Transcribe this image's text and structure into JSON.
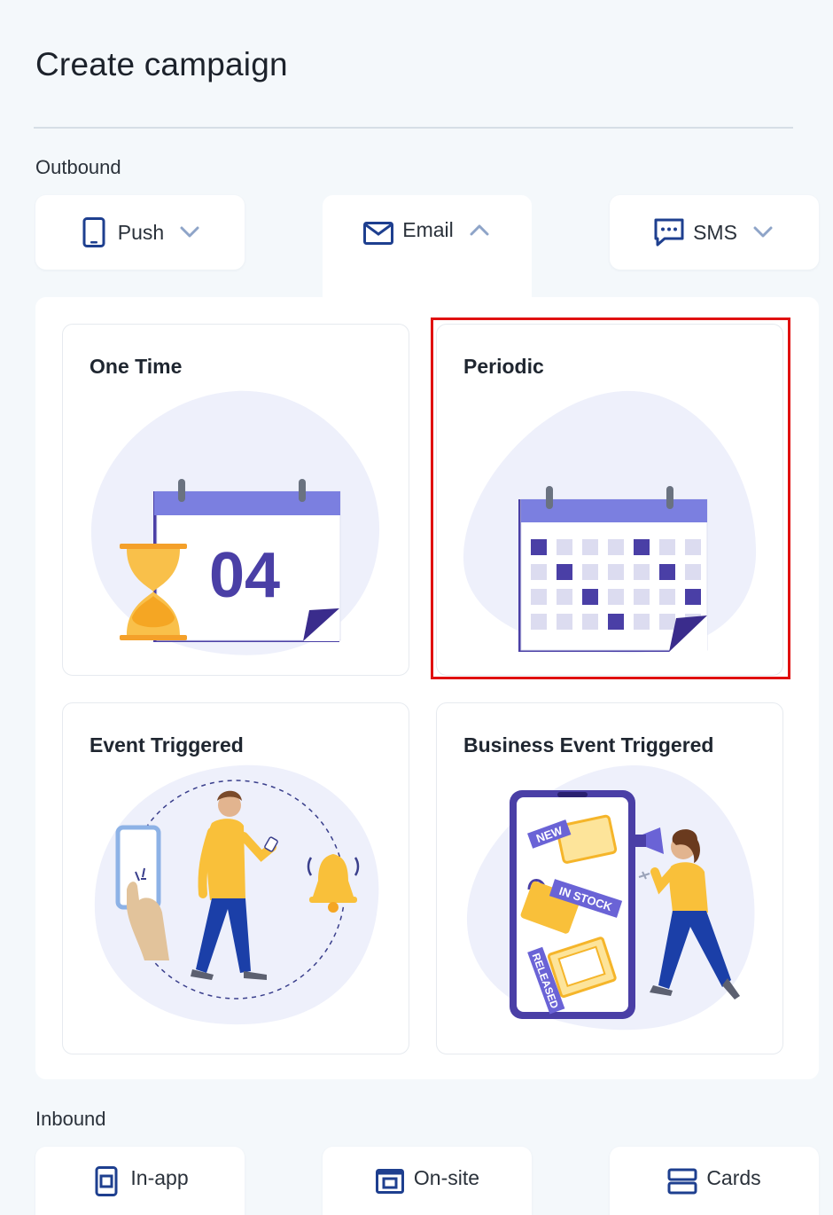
{
  "page": {
    "title": "Create campaign"
  },
  "outbound": {
    "label": "Outbound",
    "tabs": [
      {
        "label": "Push",
        "icon": "phone-icon",
        "state": "collapsed"
      },
      {
        "label": "Email",
        "icon": "mail-icon",
        "state": "expanded"
      },
      {
        "label": "SMS",
        "icon": "sms-icon",
        "state": "collapsed"
      }
    ]
  },
  "email_options": [
    {
      "title": "One Time",
      "illustration": "calendar-hourglass-illustration",
      "date_number": "04"
    },
    {
      "title": "Periodic",
      "illustration": "periodic-calendar-illustration",
      "highlighted": true
    },
    {
      "title": "Event Triggered",
      "illustration": "person-bell-illustration"
    },
    {
      "title": "Business Event Triggered",
      "illustration": "phone-megaphone-illustration",
      "tags": [
        "NEW",
        "IN STOCK",
        "RELEASED"
      ]
    }
  ],
  "inbound": {
    "label": "Inbound",
    "tabs": [
      {
        "label": "In-app",
        "icon": "in-app-icon"
      },
      {
        "label": "On-site",
        "icon": "on-site-icon"
      },
      {
        "label": "Cards",
        "icon": "cards-icon"
      }
    ]
  },
  "colors": {
    "accent": "#1e3f8f",
    "purple": "#4a3fa6",
    "lavender": "#eef0fb",
    "highlight": "#e01010",
    "yellow": "#f5b52a"
  }
}
